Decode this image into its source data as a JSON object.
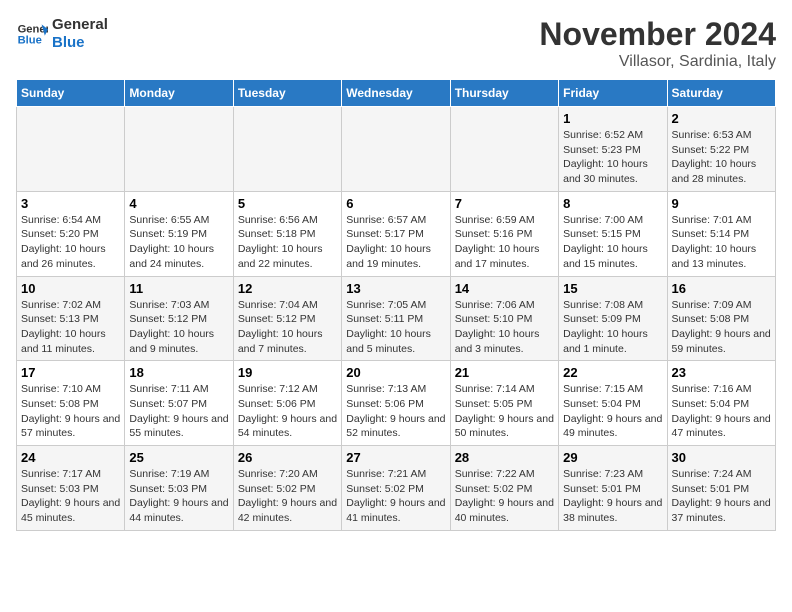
{
  "logo": {
    "line1": "General",
    "line2": "Blue"
  },
  "title": "November 2024",
  "location": "Villasor, Sardinia, Italy",
  "days_of_week": [
    "Sunday",
    "Monday",
    "Tuesday",
    "Wednesday",
    "Thursday",
    "Friday",
    "Saturday"
  ],
  "weeks": [
    [
      {
        "num": "",
        "info": ""
      },
      {
        "num": "",
        "info": ""
      },
      {
        "num": "",
        "info": ""
      },
      {
        "num": "",
        "info": ""
      },
      {
        "num": "",
        "info": ""
      },
      {
        "num": "1",
        "info": "Sunrise: 6:52 AM\nSunset: 5:23 PM\nDaylight: 10 hours and 30 minutes."
      },
      {
        "num": "2",
        "info": "Sunrise: 6:53 AM\nSunset: 5:22 PM\nDaylight: 10 hours and 28 minutes."
      }
    ],
    [
      {
        "num": "3",
        "info": "Sunrise: 6:54 AM\nSunset: 5:20 PM\nDaylight: 10 hours and 26 minutes."
      },
      {
        "num": "4",
        "info": "Sunrise: 6:55 AM\nSunset: 5:19 PM\nDaylight: 10 hours and 24 minutes."
      },
      {
        "num": "5",
        "info": "Sunrise: 6:56 AM\nSunset: 5:18 PM\nDaylight: 10 hours and 22 minutes."
      },
      {
        "num": "6",
        "info": "Sunrise: 6:57 AM\nSunset: 5:17 PM\nDaylight: 10 hours and 19 minutes."
      },
      {
        "num": "7",
        "info": "Sunrise: 6:59 AM\nSunset: 5:16 PM\nDaylight: 10 hours and 17 minutes."
      },
      {
        "num": "8",
        "info": "Sunrise: 7:00 AM\nSunset: 5:15 PM\nDaylight: 10 hours and 15 minutes."
      },
      {
        "num": "9",
        "info": "Sunrise: 7:01 AM\nSunset: 5:14 PM\nDaylight: 10 hours and 13 minutes."
      }
    ],
    [
      {
        "num": "10",
        "info": "Sunrise: 7:02 AM\nSunset: 5:13 PM\nDaylight: 10 hours and 11 minutes."
      },
      {
        "num": "11",
        "info": "Sunrise: 7:03 AM\nSunset: 5:12 PM\nDaylight: 10 hours and 9 minutes."
      },
      {
        "num": "12",
        "info": "Sunrise: 7:04 AM\nSunset: 5:12 PM\nDaylight: 10 hours and 7 minutes."
      },
      {
        "num": "13",
        "info": "Sunrise: 7:05 AM\nSunset: 5:11 PM\nDaylight: 10 hours and 5 minutes."
      },
      {
        "num": "14",
        "info": "Sunrise: 7:06 AM\nSunset: 5:10 PM\nDaylight: 10 hours and 3 minutes."
      },
      {
        "num": "15",
        "info": "Sunrise: 7:08 AM\nSunset: 5:09 PM\nDaylight: 10 hours and 1 minute."
      },
      {
        "num": "16",
        "info": "Sunrise: 7:09 AM\nSunset: 5:08 PM\nDaylight: 9 hours and 59 minutes."
      }
    ],
    [
      {
        "num": "17",
        "info": "Sunrise: 7:10 AM\nSunset: 5:08 PM\nDaylight: 9 hours and 57 minutes."
      },
      {
        "num": "18",
        "info": "Sunrise: 7:11 AM\nSunset: 5:07 PM\nDaylight: 9 hours and 55 minutes."
      },
      {
        "num": "19",
        "info": "Sunrise: 7:12 AM\nSunset: 5:06 PM\nDaylight: 9 hours and 54 minutes."
      },
      {
        "num": "20",
        "info": "Sunrise: 7:13 AM\nSunset: 5:06 PM\nDaylight: 9 hours and 52 minutes."
      },
      {
        "num": "21",
        "info": "Sunrise: 7:14 AM\nSunset: 5:05 PM\nDaylight: 9 hours and 50 minutes."
      },
      {
        "num": "22",
        "info": "Sunrise: 7:15 AM\nSunset: 5:04 PM\nDaylight: 9 hours and 49 minutes."
      },
      {
        "num": "23",
        "info": "Sunrise: 7:16 AM\nSunset: 5:04 PM\nDaylight: 9 hours and 47 minutes."
      }
    ],
    [
      {
        "num": "24",
        "info": "Sunrise: 7:17 AM\nSunset: 5:03 PM\nDaylight: 9 hours and 45 minutes."
      },
      {
        "num": "25",
        "info": "Sunrise: 7:19 AM\nSunset: 5:03 PM\nDaylight: 9 hours and 44 minutes."
      },
      {
        "num": "26",
        "info": "Sunrise: 7:20 AM\nSunset: 5:02 PM\nDaylight: 9 hours and 42 minutes."
      },
      {
        "num": "27",
        "info": "Sunrise: 7:21 AM\nSunset: 5:02 PM\nDaylight: 9 hours and 41 minutes."
      },
      {
        "num": "28",
        "info": "Sunrise: 7:22 AM\nSunset: 5:02 PM\nDaylight: 9 hours and 40 minutes."
      },
      {
        "num": "29",
        "info": "Sunrise: 7:23 AM\nSunset: 5:01 PM\nDaylight: 9 hours and 38 minutes."
      },
      {
        "num": "30",
        "info": "Sunrise: 7:24 AM\nSunset: 5:01 PM\nDaylight: 9 hours and 37 minutes."
      }
    ]
  ]
}
